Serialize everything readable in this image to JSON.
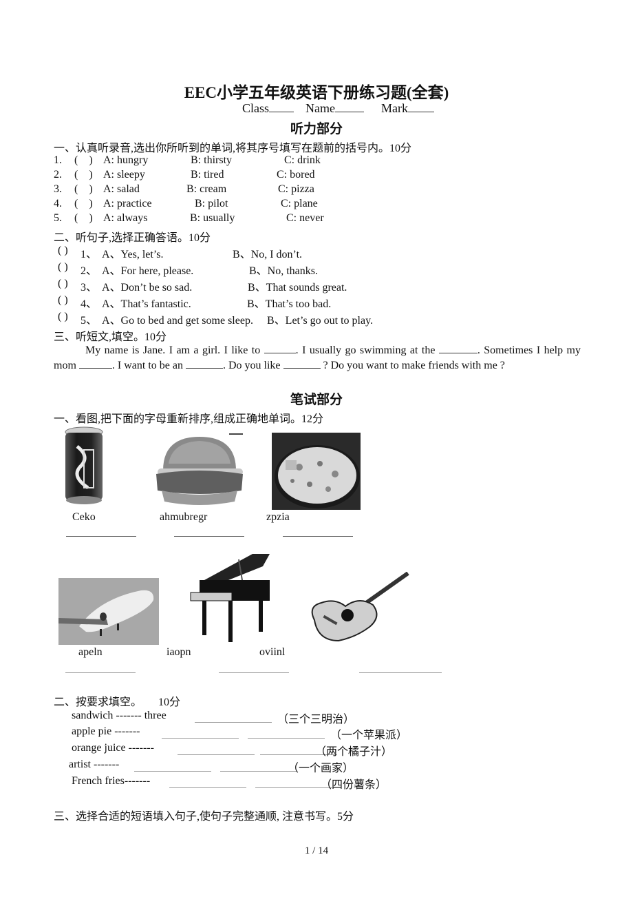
{
  "document": {
    "title": "EEC小学五年级英语下册练习题(全套)",
    "header_fields": {
      "class_label": "Class",
      "name_label": "Name",
      "mark_label": "Mark"
    },
    "page_indicator": "1 / 14"
  },
  "listening": {
    "heading": "听力部分",
    "part1": {
      "instruction": "一、认真听录音,选出你所听到的单词,将其序号填写在题前的括号内。10分",
      "items": [
        {
          "num": "1.",
          "a": "A: hungry",
          "b": "B: thirsty",
          "c": "C: drink"
        },
        {
          "num": "2.",
          "a": "A: sleepy",
          "b": "B: tired",
          "c": "C: bored"
        },
        {
          "num": "3.",
          "a": "A: salad",
          "b": "B: cream",
          "c": "C: pizza"
        },
        {
          "num": "4.",
          "a": "A: practice",
          "b": "B: pilot",
          "c": "C: plane"
        },
        {
          "num": "5.",
          "a": "A: always",
          "b": "B: usually",
          "c": "C: never"
        }
      ]
    },
    "part2": {
      "instruction": "二、听句子,选择正确答语。10分",
      "items": [
        {
          "num": "1、",
          "a": "A、Yes, let’s.",
          "b": "B、No, I don’t."
        },
        {
          "num": "2、",
          "a": "A、For here, please.",
          "b": "B、No, thanks."
        },
        {
          "num": "3、",
          "a": "A、Don’t be so sad.",
          "b": "B、That sounds great."
        },
        {
          "num": "4、",
          "a": "A、That’s fantastic.",
          "b": "B、That’s too bad."
        },
        {
          "num": "5、",
          "a": "A、Go to bed and get some sleep.",
          "b": "B、Let’s go out to play."
        }
      ]
    },
    "part3": {
      "instruction": "三、听短文,填空。10分",
      "passage": [
        "My name is Jane. I am a girl.  I like to ",
        ".  I usually go swimming at the ",
        ". Sometimes I help my mom ",
        ".  I want to be an ",
        ". Do you like ",
        " ?  Do you want to make friends with me ?"
      ]
    }
  },
  "written": {
    "heading": "笔试部分",
    "part1": {
      "instruction": "一、看图,把下面的字母重新排序,组成正确地单词。12分",
      "row1": [
        {
          "image": "coke-can-image",
          "scrambled": "Ceko"
        },
        {
          "image": "hamburger-image",
          "scrambled": "ahmubregr"
        },
        {
          "image": "pizza-image",
          "scrambled": "zpzia"
        }
      ],
      "row2": [
        {
          "image": "airplane-image",
          "scrambled": "apeln"
        },
        {
          "image": "piano-image",
          "scrambled": "iaopn"
        },
        {
          "image": "guitar-image",
          "scrambled": "oviinl"
        }
      ]
    },
    "part2": {
      "instruction": "二、按要求填空。",
      "points": "10分",
      "items": [
        {
          "word": "sandwich  -------  three",
          "hint": "（三个三明治）"
        },
        {
          "word": "apple pie  -------",
          "hint": "（一个苹果派）"
        },
        {
          "word": "orange juice  -------",
          "hint": "（两个橘子汁）"
        },
        {
          "word": "artist -------",
          "hint": "（一个画家）"
        },
        {
          "word": "French fries-------",
          "hint": "（四份薯条）"
        }
      ]
    },
    "part3": {
      "instruction": "三、选择合适的短语填入句子,使句子完整通顺, 注意书写。5分"
    }
  }
}
